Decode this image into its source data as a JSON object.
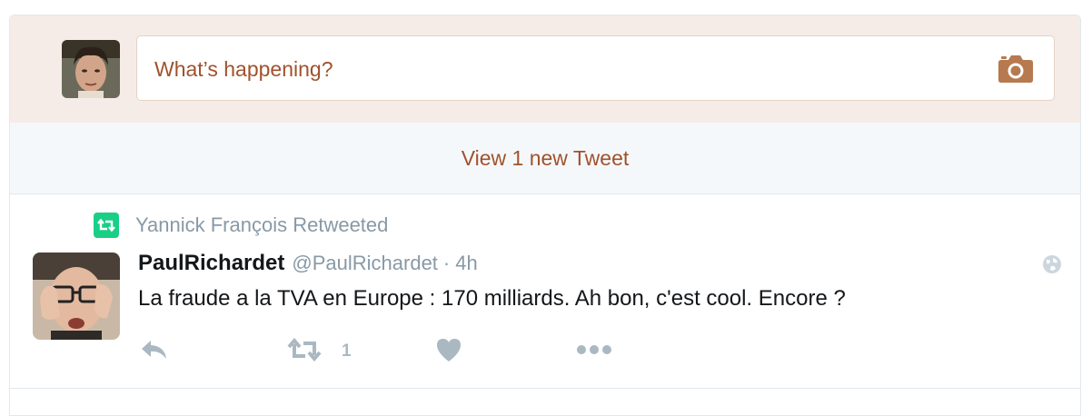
{
  "composer": {
    "placeholder": "What’s happening?"
  },
  "new_tweets_bar": {
    "label": "View 1 new Tweet"
  },
  "tweet": {
    "retweet_context": "Yannick François Retweeted",
    "author_name": "PaulRichardet",
    "author_handle": "@PaulRichardet",
    "separator": "·",
    "time": "4h",
    "text": "La fraude a la TVA en Europe : 170 milliards. Ah bon, c'est cool. Encore ?",
    "actions": {
      "retweet_count": "1"
    }
  },
  "colors": {
    "accent": "#a0522d",
    "composer_bg": "#f5ece8",
    "retweet_green": "#19cf86",
    "muted": "#8899a6",
    "action_icon": "#aab8c2"
  },
  "icons": [
    "camera-icon",
    "retweet-icon",
    "globe-icon",
    "reply-icon",
    "heart-icon",
    "more-icon"
  ]
}
